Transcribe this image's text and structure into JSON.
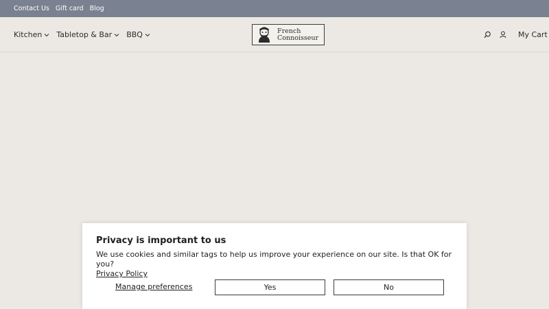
{
  "topbar": {
    "links": [
      "Contact Us",
      "Gift card",
      "Blog"
    ]
  },
  "nav": {
    "items": [
      {
        "label": "Kitchen",
        "icon": "chevron-down-icon"
      },
      {
        "label": "Tabletop & Bar",
        "icon": "chevron-down-icon"
      },
      {
        "label": "BBQ",
        "icon": "chevron-down-icon"
      }
    ]
  },
  "logo": {
    "line1": "French",
    "line2": "Connoisseur"
  },
  "header_icons": {
    "search": "search-icon",
    "account": "user-icon",
    "cart_label": "My Cart"
  },
  "consent": {
    "title": "Privacy is important to us",
    "body": "We use cookies and similar tags to help us improve your experience on our site. Is that OK for you?",
    "policy_link": "Privacy Policy",
    "manage_label": "Manage preferences",
    "yes_label": "Yes",
    "no_label": "No"
  },
  "colors": {
    "topbar_bg": "#7a8190",
    "page_bg": "#ece9e4",
    "text": "#2b2b2b"
  }
}
